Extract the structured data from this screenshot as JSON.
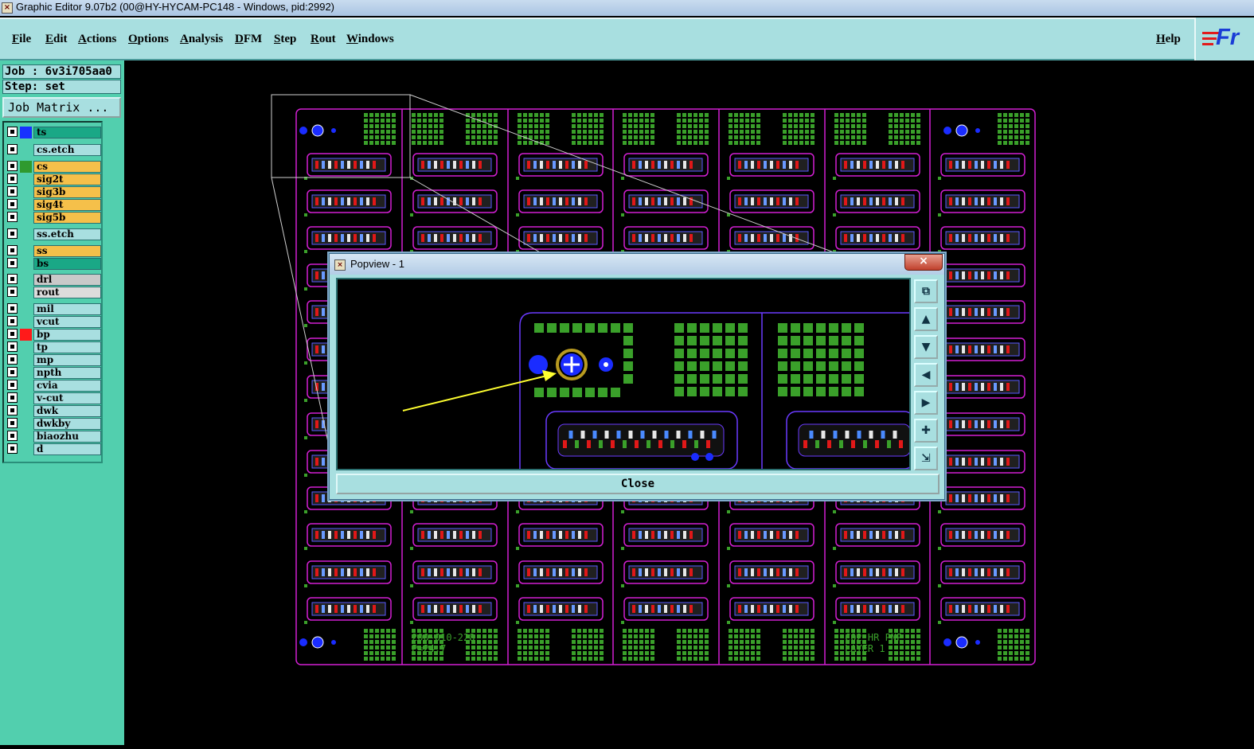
{
  "window": {
    "title": "Graphic Editor 9.07b2 (00@HY-HYCAM-PC148 - Windows, pid:2992)"
  },
  "menu": {
    "items": [
      "File",
      "Edit",
      "Actions",
      "Options",
      "Analysis",
      "DFM",
      "Step",
      "Rout",
      "Windows"
    ],
    "help": "Help"
  },
  "logo": {
    "text": "Fr"
  },
  "job": {
    "job_label": "Job : 6v3i705aa0",
    "step_label": "Step: set",
    "matrix_button": "Job Matrix ..."
  },
  "layers": [
    {
      "name": "ts",
      "bg": "#1aa886",
      "swatch": "#1830ff"
    },
    {
      "name": "cs.etch",
      "bg": "#a8dfe0",
      "swatch": ""
    },
    {
      "name": "cs",
      "bg": "#f5c04a",
      "swatch": "#2f9a2f"
    },
    {
      "name": "sig2t",
      "bg": "#f5c04a",
      "swatch": ""
    },
    {
      "name": "sig3b",
      "bg": "#f5c04a",
      "swatch": ""
    },
    {
      "name": "sig4t",
      "bg": "#f5c04a",
      "swatch": ""
    },
    {
      "name": "sig5b",
      "bg": "#f5c04a",
      "swatch": ""
    },
    {
      "name": "ss.etch",
      "bg": "#a8dfe0",
      "swatch": ""
    },
    {
      "name": "ss",
      "bg": "#f5c04a",
      "swatch": ""
    },
    {
      "name": "bs",
      "bg": "#1aa886",
      "swatch": ""
    },
    {
      "name": "drl",
      "bg": "#c9c9c9",
      "swatch": ""
    },
    {
      "name": "rout",
      "bg": "#dcdcdc",
      "swatch": ""
    },
    {
      "name": "mil",
      "bg": "#a8dfe0",
      "swatch": ""
    },
    {
      "name": "vcut",
      "bg": "#a8dfe0",
      "swatch": ""
    },
    {
      "name": "bp",
      "bg": "#a8dfe0",
      "swatch": "#ff1a1a"
    },
    {
      "name": "tp",
      "bg": "#a8dfe0",
      "swatch": ""
    },
    {
      "name": "mp",
      "bg": "#a8dfe0",
      "swatch": ""
    },
    {
      "name": "npth",
      "bg": "#a8dfe0",
      "swatch": ""
    },
    {
      "name": "cvia",
      "bg": "#a8dfe0",
      "swatch": ""
    },
    {
      "name": "v-cut",
      "bg": "#a8dfe0",
      "swatch": ""
    },
    {
      "name": "dwk",
      "bg": "#a8dfe0",
      "swatch": ""
    },
    {
      "name": "dwkby",
      "bg": "#a8dfe0",
      "swatch": ""
    },
    {
      "name": "biaozhu",
      "bg": "#a8dfe0",
      "swatch": ""
    },
    {
      "name": "d",
      "bg": "#a8dfe0",
      "swatch": ""
    }
  ],
  "board": {
    "text_left": [
      "200-010-228 -",
      "P=24.7"
    ],
    "text_right": [
      "C02 HR PNP",
      "LAYER 1"
    ]
  },
  "popview": {
    "title": "Popview - 1",
    "close_x": "×",
    "close_button": "Close",
    "tools": [
      "zoom-home-icon",
      "pan-up-icon",
      "pan-down-icon",
      "pan-left-icon",
      "pan-right-icon",
      "zoom-in-icon",
      "zoom-out-icon"
    ]
  },
  "colors": {
    "outline": "#d21fd2",
    "pad": "#3aa02a",
    "hole": "#1a2cff",
    "trace": "#e01818",
    "zoomline": "#cfcfcf",
    "arrow": "#ffff30"
  }
}
